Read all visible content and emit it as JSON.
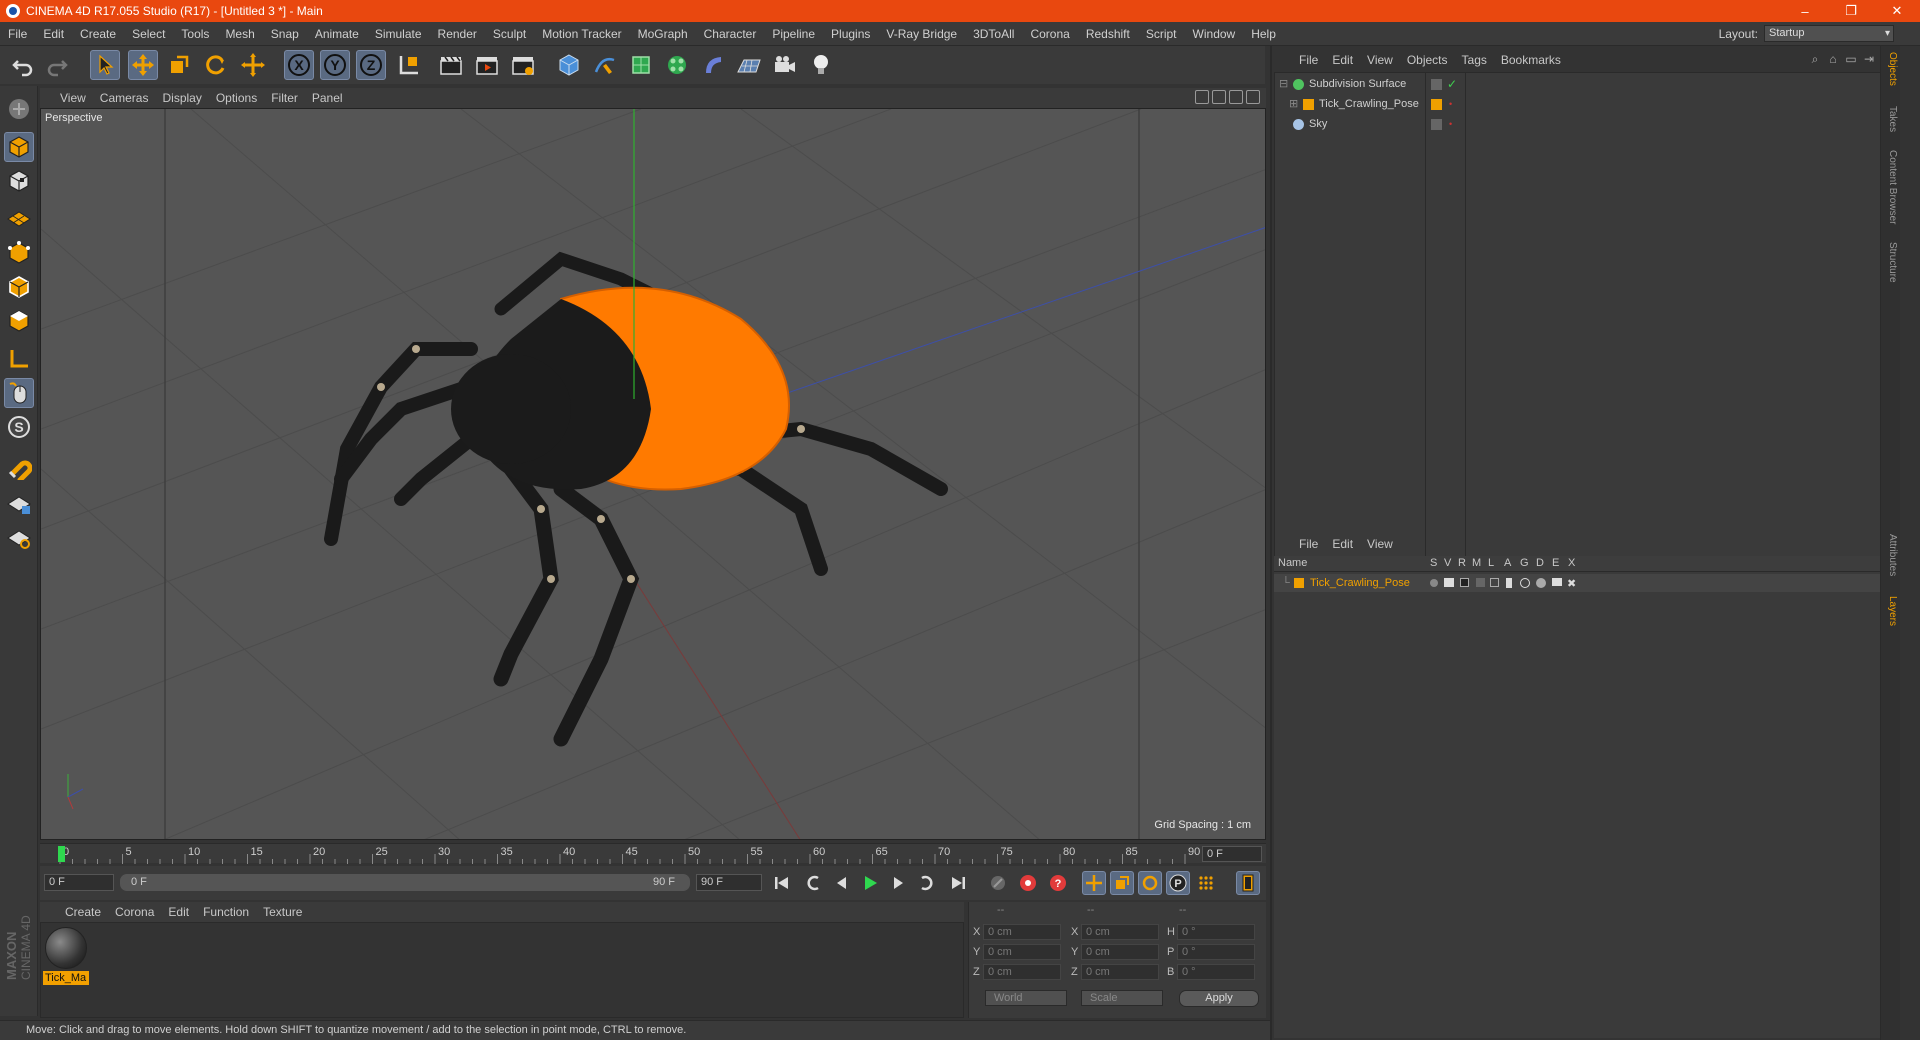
{
  "window": {
    "title": "CINEMA 4D R17.055 Studio (R17) - [Untitled 3 *] - Main",
    "controls": [
      "–",
      "❐",
      "✕"
    ]
  },
  "menubar": {
    "items": [
      "File",
      "Edit",
      "Create",
      "Select",
      "Tools",
      "Mesh",
      "Snap",
      "Animate",
      "Simulate",
      "Render",
      "Sculpt",
      "Motion Tracker",
      "MoGraph",
      "Character",
      "Pipeline",
      "Plugins",
      "V-Ray Bridge",
      "3DToAll",
      "Corona",
      "Redshift",
      "Script",
      "Window",
      "Help"
    ],
    "layout_label": "Layout:",
    "layout_value": "Startup"
  },
  "viewport": {
    "menu": [
      "View",
      "Cameras",
      "Display",
      "Options",
      "Filter",
      "Panel"
    ],
    "camera_label": "Perspective",
    "grid_spacing": "Grid Spacing : 1 cm"
  },
  "timeline": {
    "ticks": [
      "0",
      "5",
      "10",
      "15",
      "20",
      "25",
      "30",
      "35",
      "40",
      "45",
      "50",
      "55",
      "60",
      "65",
      "70",
      "75",
      "80",
      "85",
      "90"
    ],
    "current_frame": "0 F",
    "start_field": "0 F",
    "range_start": "0 F",
    "range_end": "90 F",
    "end_field": "90 F"
  },
  "material_manager": {
    "menu": [
      "Create",
      "Corona",
      "Edit",
      "Function",
      "Texture"
    ],
    "material_name": "Tick_Ma"
  },
  "coordinates": {
    "headers": [
      "--",
      "--",
      "--"
    ],
    "rows": [
      {
        "a": "X",
        "av": "0 cm",
        "b": "X",
        "bv": "0 cm",
        "c": "H",
        "cv": "0 °"
      },
      {
        "a": "Y",
        "av": "0 cm",
        "b": "Y",
        "bv": "0 cm",
        "c": "P",
        "cv": "0 °"
      },
      {
        "a": "Z",
        "av": "0 cm",
        "b": "Z",
        "bv": "0 cm",
        "c": "B",
        "cv": "0 °"
      }
    ],
    "world": "World",
    "scale": "Scale",
    "apply": "Apply"
  },
  "status": "Move: Click and drag to move elements. Hold down SHIFT to quantize movement / add to the selection in point mode, CTRL to remove.",
  "object_manager": {
    "menu": [
      "File",
      "Edit",
      "View",
      "Objects",
      "Tags",
      "Bookmarks"
    ],
    "objects": [
      {
        "name": "Subdivision Surface",
        "color": "#4fc35f"
      },
      {
        "name": "Tick_Crawling_Pose",
        "color": "#f0a000"
      },
      {
        "name": "Sky",
        "color": "#a7c4e6"
      }
    ]
  },
  "layer_manager": {
    "menu": [
      "File",
      "Edit",
      "View"
    ],
    "columns": [
      "Name",
      "S",
      "V",
      "R",
      "M",
      "L",
      "A",
      "G",
      "D",
      "E",
      "X"
    ],
    "layer_name": "Tick_Crawling_Pose"
  },
  "side_tabs": [
    "Objects",
    "Takes",
    "Content Browser",
    "Structure",
    "Attributes",
    "Layers"
  ],
  "brand": "MAXON CINEMA 4D",
  "colors": {
    "accent": "#e9480f",
    "tick_body": "#1a1a1a",
    "tick_abdomen": "#ff7a00",
    "selection": "#f2a000"
  }
}
